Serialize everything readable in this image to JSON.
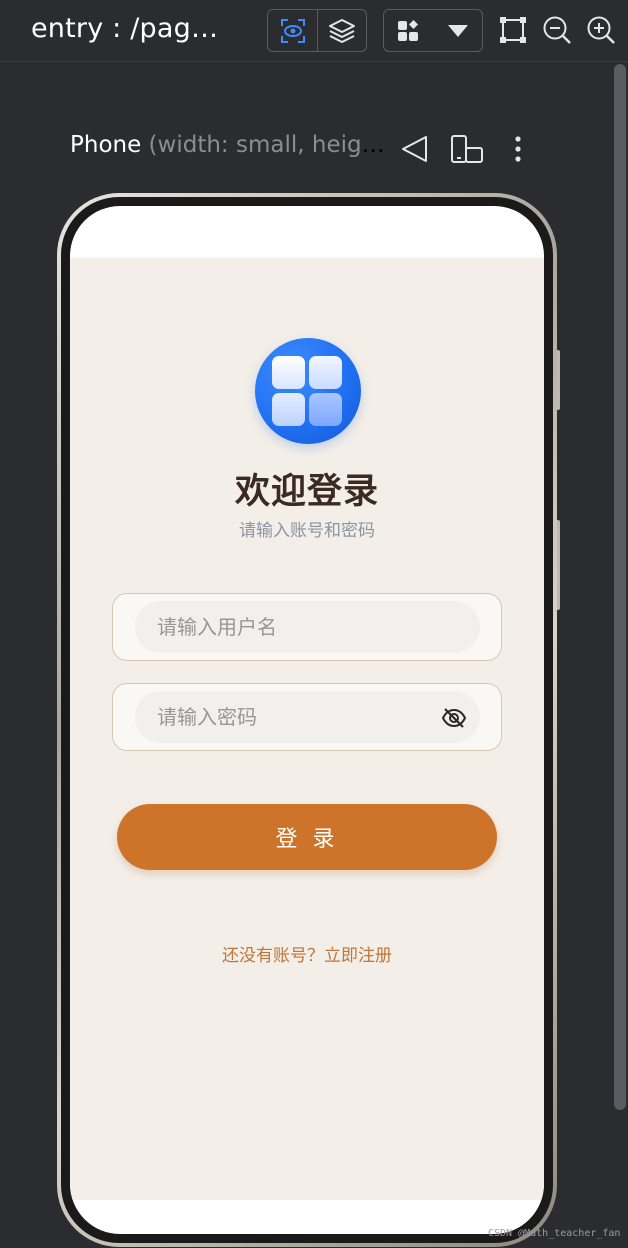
{
  "toolbar": {
    "title": "entry : /page…",
    "icons": [
      "inspect-icon",
      "layers-icon",
      "components-icon",
      "dropdown-icon",
      "frame-icon",
      "zoom-out-icon",
      "zoom-in-icon"
    ]
  },
  "device": {
    "name": "Phone",
    "dims": " (width: small, heigh…"
  },
  "login": {
    "welcome": "欢迎登录",
    "subtitle": "请输入账号和密码",
    "username_placeholder": "请输入用户名",
    "username_value": "",
    "password_placeholder": "请输入密码",
    "password_value": "",
    "login_label": "登 录",
    "register_text": "还没有账号？立即注册"
  },
  "colors": {
    "accent": "#cd742a",
    "background": "#f3eee8",
    "title_text": "#3b2a22",
    "link": "#c0753a"
  },
  "watermark": "CSDN @Math_teacher_fan"
}
